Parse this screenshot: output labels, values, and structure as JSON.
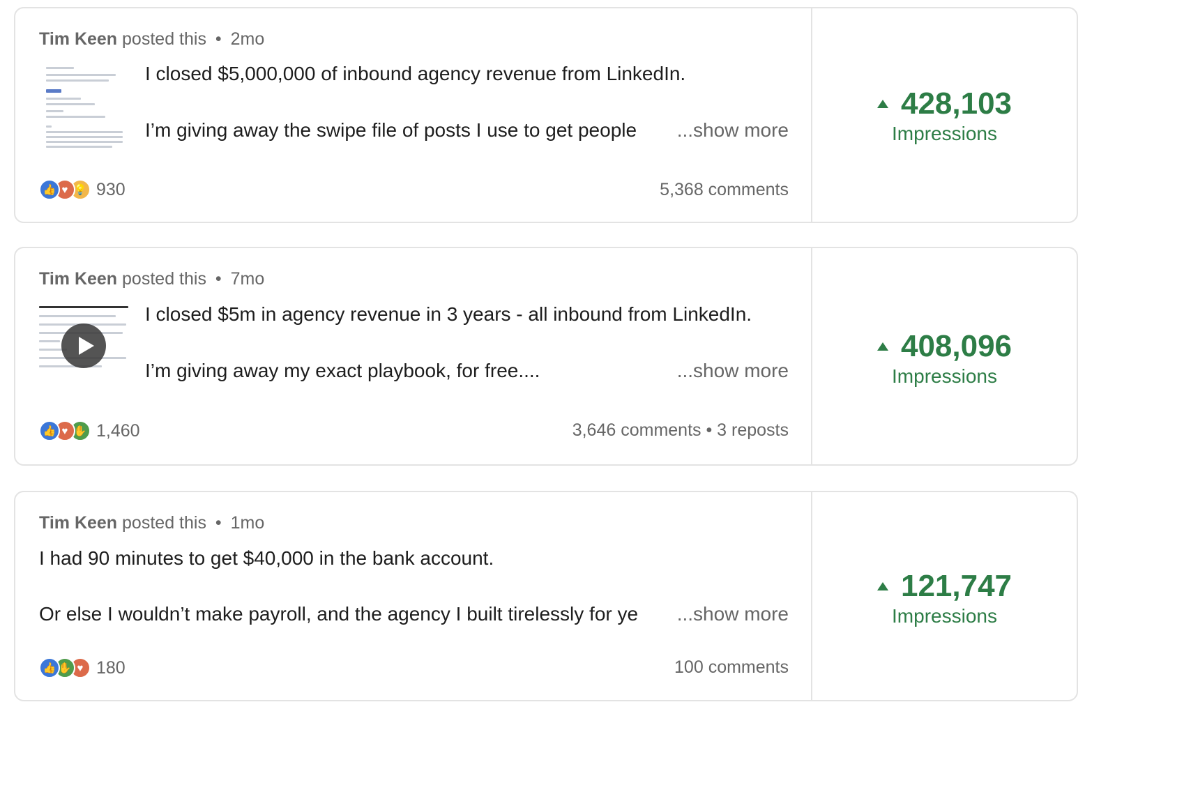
{
  "colors": {
    "accent_green": "#2d7d46",
    "muted_text": "#666666",
    "border": "#e3e3e3"
  },
  "posts": [
    {
      "author": "Tim Keen",
      "action": "posted this",
      "age": "2mo",
      "thumbnail": "document-thumbnail",
      "line1": "I closed $5,000,000 of inbound agency revenue from LinkedIn.",
      "line2": "I’m giving away the swipe file of posts I use to get people",
      "show_more": "...show more",
      "reaction_icons": [
        "like-icon",
        "love-icon",
        "insightful-icon"
      ],
      "reaction_count": "930",
      "stats": "5,368 comments",
      "impressions_value": "428,103",
      "impressions_label": "Impressions"
    },
    {
      "author": "Tim Keen",
      "action": "posted this",
      "age": "7mo",
      "thumbnail": "video-thumbnail",
      "line1": "I closed $5m in agency revenue in 3 years - all inbound from LinkedIn.",
      "line2": "I’m giving away my exact playbook, for free....",
      "show_more": "...show more",
      "reaction_icons": [
        "like-icon",
        "love-icon",
        "support-icon"
      ],
      "reaction_count": "1,460",
      "stats": "3,646 comments • 3 reposts",
      "impressions_value": "408,096",
      "impressions_label": "Impressions"
    },
    {
      "author": "Tim Keen",
      "action": "posted this",
      "age": "1mo",
      "thumbnail": "",
      "line1": "I had 90 minutes to get $40,000 in the bank account.",
      "line2": "Or else I wouldn’t make payroll, and the agency I built tirelessly for ye",
      "show_more": "...show more",
      "reaction_icons": [
        "like-icon",
        "support-icon",
        "love-icon"
      ],
      "reaction_count": "180",
      "stats": "100 comments",
      "impressions_value": "121,747",
      "impressions_label": "Impressions"
    }
  ]
}
